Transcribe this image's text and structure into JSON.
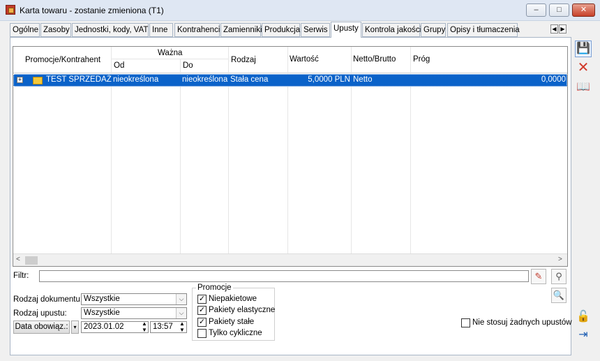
{
  "window": {
    "title": "Karta towaru - zostanie zmieniona (T1)",
    "min": "–",
    "max": "□",
    "close": "✕"
  },
  "tabs": [
    {
      "label": "Ogólne"
    },
    {
      "label": "Zasoby"
    },
    {
      "label": "Jednostki, kody, VAT"
    },
    {
      "label": "Inne"
    },
    {
      "label": "Kontrahenci"
    },
    {
      "label": "Zamienniki"
    },
    {
      "label": "Produkcja"
    },
    {
      "label": "Serwis"
    },
    {
      "label": "Upusty"
    },
    {
      "label": "Kontrola jakości"
    },
    {
      "label": "Grupy"
    },
    {
      "label": "Opisy i tłumaczenia"
    }
  ],
  "active_tab": "Upusty",
  "grid": {
    "headers": {
      "promo": "Promocje/Kontrahent",
      "wazna": "Ważna",
      "od": "Od",
      "do": "Do",
      "rodzaj": "Rodzaj",
      "wartosc": "Wartość",
      "netto": "Netto/Brutto",
      "prog": "Próg"
    },
    "rows": [
      {
        "expander": "+",
        "name": "TEST SPRZEDAŻ",
        "od": "nieokreślona",
        "do": "nieokreślona",
        "rodzaj": "Stała cena",
        "wartosc": "5,0000 PLN",
        "netto": "Netto",
        "prog": "0,0000"
      }
    ],
    "scroll_left": "<",
    "scroll_right": ">"
  },
  "filter": {
    "label": "Filtr:",
    "value": ""
  },
  "fields": {
    "rodzaj_dok_label": "Rodzaj dokumentu:",
    "rodzaj_dok_value": "Wszystkie",
    "rodzaj_up_label": "Rodzaj upustu:",
    "rodzaj_up_value": "Wszystkie",
    "date_button": "Data obowiąz.:",
    "date_value": "2023.01.02",
    "time_value": "13:57"
  },
  "promocje": {
    "title": "Promocje",
    "items": [
      {
        "label": "Niepakietowe",
        "checked": true
      },
      {
        "label": "Pakiety elastyczne",
        "checked": true
      },
      {
        "label": "Pakiety stałe",
        "checked": true
      },
      {
        "label": "Tylko cykliczne",
        "checked": false
      }
    ]
  },
  "nie_stosuj": {
    "label": "Nie stosuj żadnych upustów",
    "checked": false
  }
}
